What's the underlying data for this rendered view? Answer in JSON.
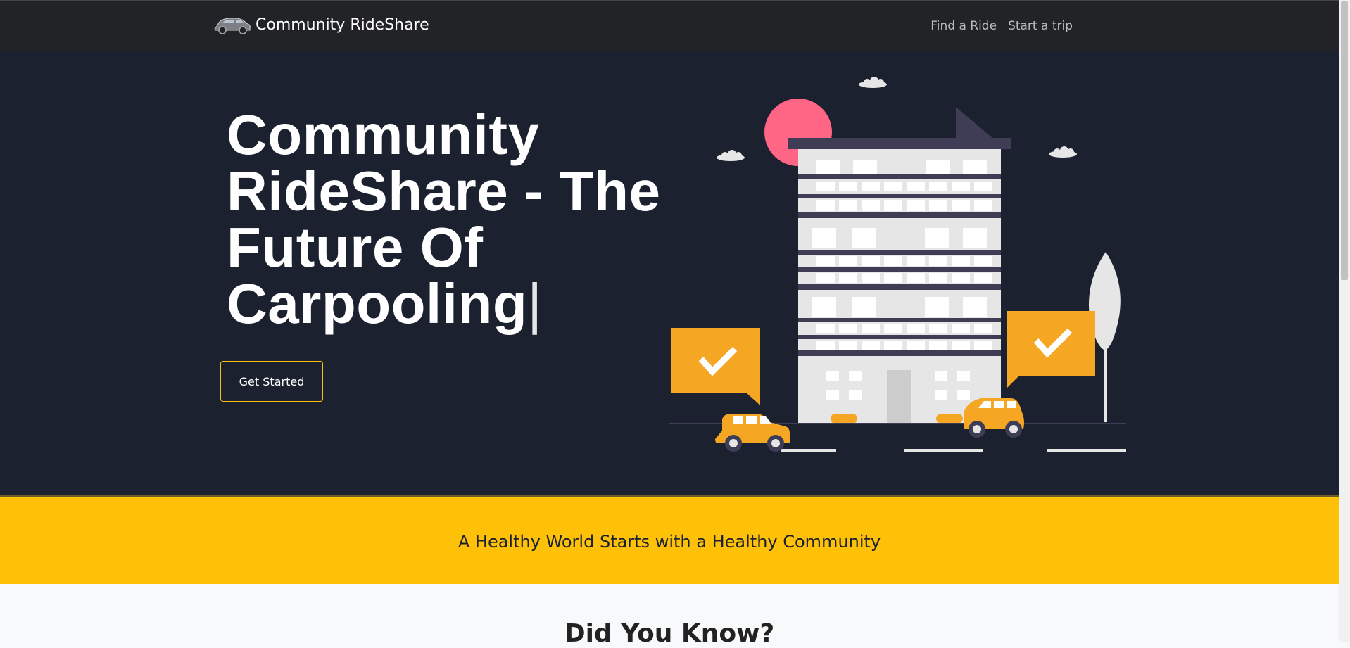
{
  "navbar": {
    "brand": "Community RideShare",
    "brand_icon": "car-logo-icon",
    "links": [
      "Find a Ride",
      "Start a trip"
    ]
  },
  "hero": {
    "title": "Community RideShare - The Future Of Carpooling",
    "cursor": "|",
    "cta_label": "Get Started",
    "illustration": "city-building-with-taxis-illustration"
  },
  "banner": {
    "text": "A Healthy World Starts with a Healthy Community"
  },
  "section": {
    "title": "Did You Know?"
  },
  "colors": {
    "navbar": "#222326",
    "hero_bg": "#1c2130",
    "accent": "#ffc107",
    "taxi": "#f5a623",
    "sun": "#ff6584"
  }
}
